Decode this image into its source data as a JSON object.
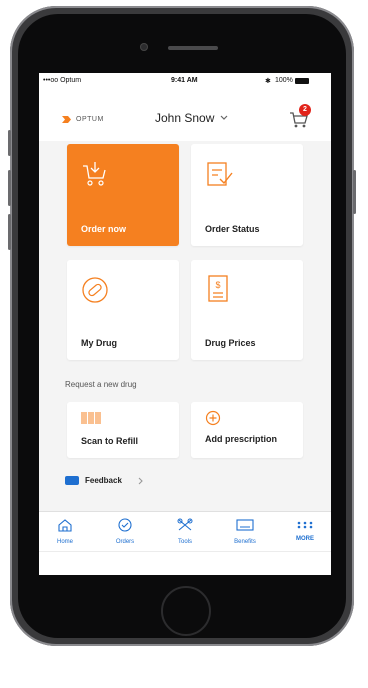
{
  "status_bar": {
    "carrier": "•••oo Optum",
    "time": "9:41 AM",
    "battery": "100%"
  },
  "header": {
    "logo_text": "OPTUM",
    "user_name": "John Snow",
    "cart_count": "2"
  },
  "tiles": {
    "order_now": "Order now",
    "order_status": "Order Status",
    "my_drug": "My Drug",
    "drug_prices": "Drug Prices"
  },
  "section": {
    "title": "Request a new drug"
  },
  "actions": {
    "scan_to_refill": "Scan to Refill",
    "add_prescription": "Add prescription"
  },
  "feedback": {
    "label": "Feedback"
  },
  "tabbar": {
    "items": [
      {
        "label": "Home",
        "icon": "home-icon"
      },
      {
        "label": "Orders",
        "icon": "check-circle-icon"
      },
      {
        "label": "Tools",
        "icon": "tools-icon"
      },
      {
        "label": "Benefits",
        "icon": "card-icon"
      },
      {
        "label": "MORE",
        "icon": "more-icon"
      }
    ]
  },
  "colors": {
    "accent": "#f58020",
    "link_blue": "#1e6fd0",
    "badge_red": "#e2231a",
    "screen_bg": "#f4f4f4"
  }
}
